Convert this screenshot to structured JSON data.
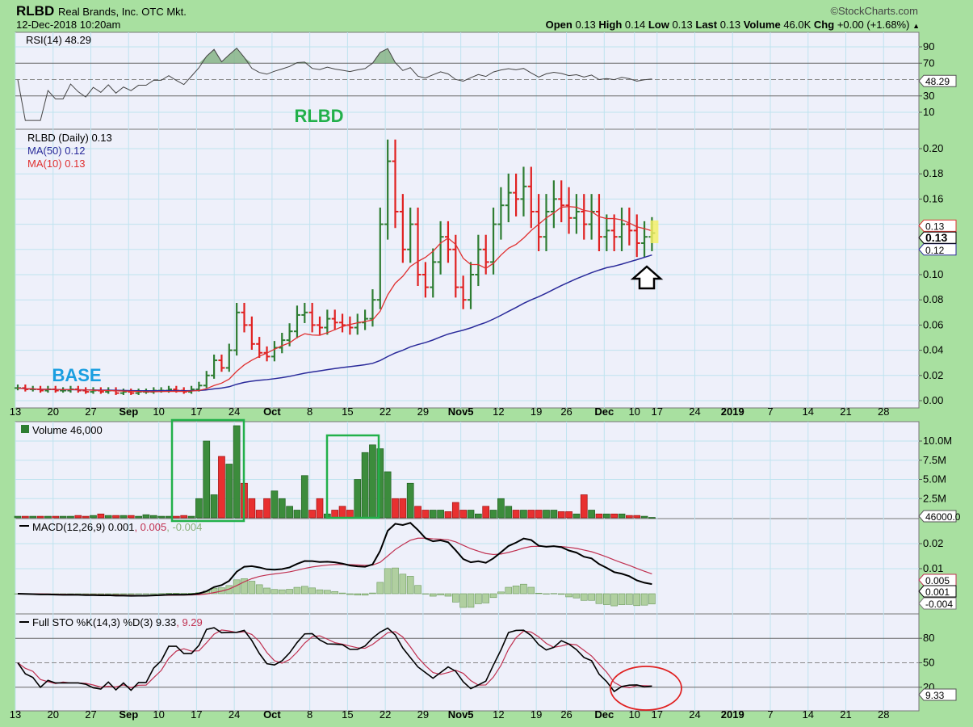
{
  "header": {
    "symbol": "RLBD",
    "company": "Real Brands, Inc. OTC Mkt.",
    "datetime": "12-Dec-2018 10:20am",
    "copyright": "©StockCharts.com",
    "quote": {
      "open_label": "Open",
      "open": "0.13",
      "high_label": "High",
      "high": "0.14",
      "low_label": "Low",
      "low": "0.13",
      "last_label": "Last",
      "last": "0.13",
      "volume_label": "Volume",
      "volume": "46.0K",
      "chg_label": "Chg",
      "chg": "+0.00 (+1.68%)",
      "arrow": "▲"
    }
  },
  "annotations": {
    "title": "RLBD",
    "base": "BASE"
  },
  "colors": {
    "up": "#2e7d32",
    "down": "#e02020",
    "ma50": "#2a2a9a",
    "ma10": "#e03030",
    "background": "#a8e0a0",
    "panel": "#eef0fa",
    "annotation_title": "#22b04a",
    "annotation_base": "#1a9ee0"
  },
  "chart_data": {
    "type": "line",
    "title": "RLBD (Daily)",
    "x_labels": [
      "13",
      "20",
      "27",
      "Sep",
      "10",
      "17",
      "24",
      "Oct",
      "8",
      "15",
      "22",
      "29",
      "Nov5",
      "12",
      "19",
      "26",
      "Dec",
      "10",
      "17",
      "24",
      "2019",
      "7",
      "14",
      "21",
      "28"
    ],
    "week_start_index": [
      0,
      5,
      10,
      15,
      19,
      24,
      29,
      34,
      39,
      44,
      49,
      54,
      59,
      64,
      69,
      73,
      78,
      82,
      85,
      90,
      95,
      100,
      105,
      110,
      115
    ],
    "close": [
      0.01,
      0.009,
      0.009,
      0.008,
      0.009,
      0.008,
      0.008,
      0.009,
      0.008,
      0.007,
      0.008,
      0.007,
      0.008,
      0.006,
      0.007,
      0.006,
      0.007,
      0.007,
      0.008,
      0.008,
      0.009,
      0.008,
      0.007,
      0.009,
      0.012,
      0.02,
      0.032,
      0.026,
      0.04,
      0.07,
      0.06,
      0.045,
      0.038,
      0.035,
      0.042,
      0.048,
      0.055,
      0.068,
      0.07,
      0.06,
      0.058,
      0.065,
      0.062,
      0.06,
      0.058,
      0.062,
      0.065,
      0.08,
      0.14,
      0.19,
      0.15,
      0.12,
      0.14,
      0.1,
      0.09,
      0.11,
      0.13,
      0.12,
      0.09,
      0.08,
      0.1,
      0.12,
      0.11,
      0.14,
      0.155,
      0.165,
      0.16,
      0.17,
      0.15,
      0.13,
      0.15,
      0.16,
      0.155,
      0.145,
      0.15,
      0.14,
      0.15,
      0.13,
      0.135,
      0.13,
      0.14,
      0.135,
      0.125,
      0.13,
      0.133
    ],
    "volume_millions": [
      0.2,
      0.2,
      0.2,
      0.2,
      0.2,
      0.2,
      0.2,
      0.2,
      0.3,
      0.2,
      0.3,
      0.5,
      0.3,
      0.3,
      0.3,
      0.3,
      0.2,
      0.4,
      0.3,
      0.2,
      0.2,
      0.2,
      0.3,
      0.2,
      2.5,
      10,
      3,
      8,
      7,
      12,
      4.5,
      2.5,
      1,
      2.5,
      3.5,
      2.5,
      1.5,
      1,
      5.5,
      1,
      2.5,
      0.5,
      1,
      1.5,
      1,
      5,
      8.5,
      9.5,
      9,
      6,
      2.5,
      2.5,
      4.5,
      1.5,
      1,
      1,
      1,
      0.8,
      2,
      1,
      1,
      0.5,
      1.5,
      1,
      2.5,
      1.5,
      1,
      1,
      1,
      1,
      1,
      1,
      0.8,
      0.8,
      0.5,
      3,
      1,
      0.5,
      0.5,
      0.5,
      0.5,
      0.3,
      0.3,
      0.2,
      0.05
    ],
    "price_axis": {
      "ticks": [
        "0.00",
        "0.02",
        "0.04",
        "0.06",
        "0.08",
        "0.10",
        "0.12",
        "0.14",
        "0.16",
        "0.18",
        "0.20"
      ],
      "ylim": [
        0,
        0.21
      ]
    },
    "rsi_axis": {
      "ticks": [
        "90",
        "70",
        "30",
        "10"
      ]
    },
    "volume_axis": {
      "ticks": [
        "10.0M",
        "7.5M",
        "5.0M",
        "2.5M"
      ]
    },
    "macd_axis": {
      "ticks": [
        "0.02",
        "0.01"
      ]
    },
    "sto_axis": {
      "ticks": [
        "80",
        "50",
        "20"
      ]
    },
    "legends": {
      "rsi": "RSI(14) 48.29",
      "price": "RLBD (Daily) 0.13",
      "ma50": "MA(50) 0.12",
      "ma10": "MA(10) 0.13",
      "volume": "Volume 46,000",
      "macd_a": "MACD(12,26,9) 0.001",
      "macd_b": ", 0.005",
      "macd_c": ", -0.004",
      "sto_a": "Full STO %K(14,3) %D(3) 9.33",
      "sto_b": ", 9.29"
    },
    "tags": {
      "rsi": "48.29",
      "ma10": "0.13",
      "last": "0.13",
      "ma50": "0.12",
      "volume": "46000.0",
      "macd_signal": "0.005",
      "macd": "0.001",
      "macd_hist": "-0.004",
      "sto": "9.33"
    }
  }
}
